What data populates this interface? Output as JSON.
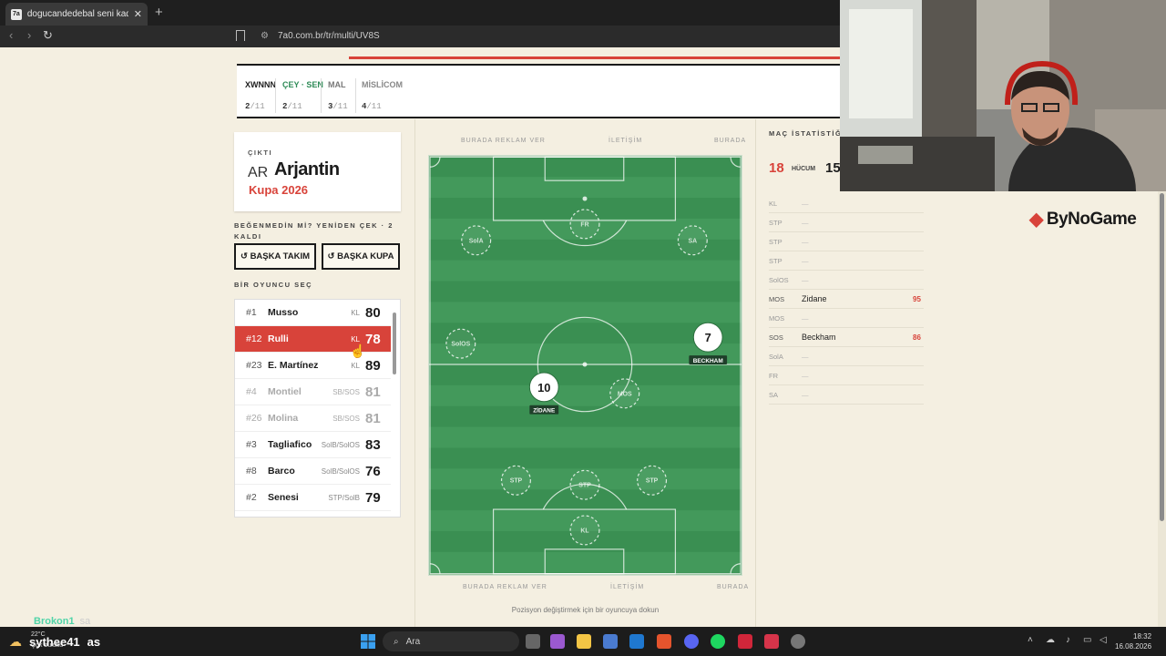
{
  "browser": {
    "tab_title": "dogucandedebal seni kadroya ç",
    "favicon_text": "7a",
    "url": "7a0.com.br/tr/multi/UV8S"
  },
  "matches": [
    {
      "name": "XWNNN",
      "score": "2",
      "total": "/11",
      "color": "#1a1a1a"
    },
    {
      "name": "ÇEY · SEN",
      "score": "2",
      "total": "/11",
      "color": "#2e8b57"
    },
    {
      "name": "MAL",
      "score": "3",
      "total": "/11",
      "color": "#777777"
    },
    {
      "name": "MİSLİCOM",
      "score": "4",
      "total": "/11",
      "color": "#888888"
    }
  ],
  "result": {
    "label": "ÇIKTI",
    "country_code": "AR",
    "team": "Arjantin",
    "cup": "Kupa 2026"
  },
  "reroll": {
    "text": "BEĞENMEDİN Mİ? YENİDEN ÇEK · 2 KALDI",
    "team_button": "↺ BAŞKA TAKIM",
    "cup_button": "↺ BAŞKA KUPA"
  },
  "select_header": "BİR OYUNCU SEÇ",
  "players": [
    {
      "num": "#1",
      "name": "Musso",
      "pos": "KL",
      "rating": "80",
      "state": "normal"
    },
    {
      "num": "#12",
      "name": "Rulli",
      "pos": "KL",
      "rating": "78",
      "state": "selected"
    },
    {
      "num": "#23",
      "name": "E. Martínez",
      "pos": "KL",
      "rating": "89",
      "state": "normal"
    },
    {
      "num": "#4",
      "name": "Montiel",
      "pos": "SB/SOS",
      "rating": "81",
      "state": "dim"
    },
    {
      "num": "#26",
      "name": "Molina",
      "pos": "SB/SOS",
      "rating": "81",
      "state": "dim"
    },
    {
      "num": "#3",
      "name": "Tagliafico",
      "pos": "SolB/SolOS",
      "rating": "83",
      "state": "normal"
    },
    {
      "num": "#8",
      "name": "Barco",
      "pos": "SolB/SolOS",
      "rating": "76",
      "state": "normal"
    },
    {
      "num": "#2",
      "name": "Senesi",
      "pos": "STP/SolB",
      "rating": "79",
      "state": "normal"
    }
  ],
  "ads": {
    "a1": "BURADA REKLAM VER",
    "a2": "İLETİŞİM",
    "a3": "BURADA"
  },
  "pitch": {
    "slots": [
      "FR",
      "SolA",
      "SA",
      "SolOS",
      "MOS",
      "STP",
      "STP",
      "STP",
      "KL"
    ],
    "placed": [
      {
        "number": "10",
        "name": "ZİDANE"
      },
      {
        "number": "7",
        "name": "BECKHAM"
      }
    ]
  },
  "hint": "Pozisyon değiştirmek için bir oyuncuya dokun",
  "stats": {
    "header": "MAÇ İSTATİSTİĞ",
    "attack_value": "18",
    "attack_label": "HÜCUM",
    "second_value": "15",
    "rows": [
      {
        "pos": "KL",
        "player": "",
        "value": ""
      },
      {
        "pos": "STP",
        "player": "",
        "value": ""
      },
      {
        "pos": "STP",
        "player": "",
        "value": ""
      },
      {
        "pos": "STP",
        "player": "",
        "value": ""
      },
      {
        "pos": "SolOS",
        "player": "",
        "value": ""
      },
      {
        "pos": "MOS",
        "player": "Zidane",
        "value": "95"
      },
      {
        "pos": "MOS",
        "player": "",
        "value": ""
      },
      {
        "pos": "SOS",
        "player": "Beckham",
        "value": "86"
      },
      {
        "pos": "SolA",
        "player": "",
        "value": ""
      },
      {
        "pos": "FR",
        "player": "",
        "value": ""
      },
      {
        "pos": "SA",
        "player": "",
        "value": ""
      }
    ],
    "empty_mark": "—"
  },
  "overlay": {
    "logo": "ByNoGame",
    "chat_user": "Brokon1",
    "chat_msg": "sa",
    "chat2_user": "sythee41",
    "chat2_msg": "as"
  },
  "taskbar": {
    "search": "Ara",
    "time": "18:32",
    "date": "16.08.2026",
    "weather": "22°C",
    "weather_desc": "Çok bulutlu"
  }
}
